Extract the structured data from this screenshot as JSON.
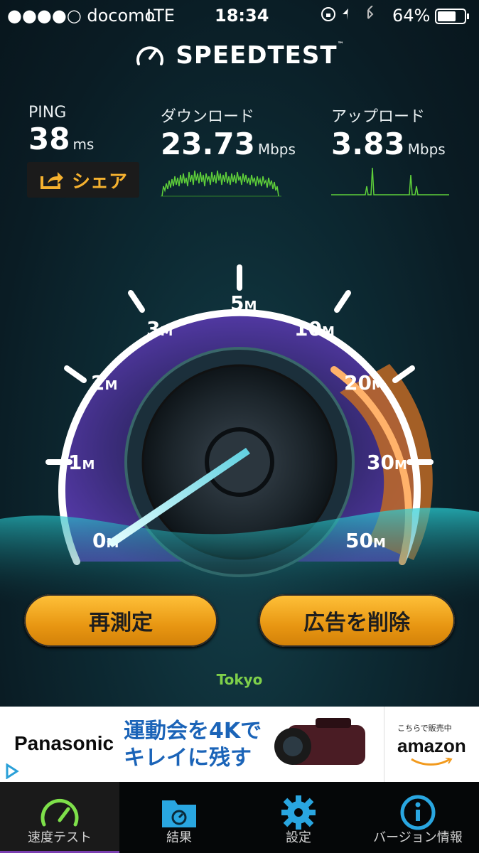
{
  "status": {
    "carrier": "●●●●○ docomo",
    "network": "LTE",
    "time": "18:34",
    "battery": "64%"
  },
  "app": {
    "logo": "SPEEDTEST",
    "logo_mark": "™"
  },
  "metrics": {
    "ping": {
      "label": "PING",
      "value": "38",
      "unit": "ms"
    },
    "download": {
      "label": "ダウンロード",
      "value": "23.73",
      "unit": "Mbps"
    },
    "upload": {
      "label": "アップロード",
      "value": "3.83",
      "unit": "Mbps"
    }
  },
  "share_label": "シェア",
  "gauge": {
    "ticks": [
      "0",
      "1",
      "2",
      "3",
      "5",
      "10",
      "20",
      "30",
      "50"
    ],
    "tick_unit": "M",
    "needle_value": "0",
    "accent": "#ff8a2a",
    "ring_color": "#a06cff"
  },
  "buttons": {
    "retest": "再測定",
    "remove_ads": "広告を削除"
  },
  "server": "Tokyo",
  "ad": {
    "brand": "Panasonic",
    "copy_line1": "運動会を4Kで",
    "copy_line2": "キレイに残す",
    "amazon_small": "こちらで販売中",
    "amazon_logo": "amazon"
  },
  "tabs": [
    {
      "label": "速度テスト",
      "icon": "speedometer-icon",
      "active": true
    },
    {
      "label": "結果",
      "icon": "results-folder-icon",
      "active": false
    },
    {
      "label": "設定",
      "icon": "gear-icon",
      "active": false
    },
    {
      "label": "バージョン情報",
      "icon": "info-icon",
      "active": false
    }
  ]
}
